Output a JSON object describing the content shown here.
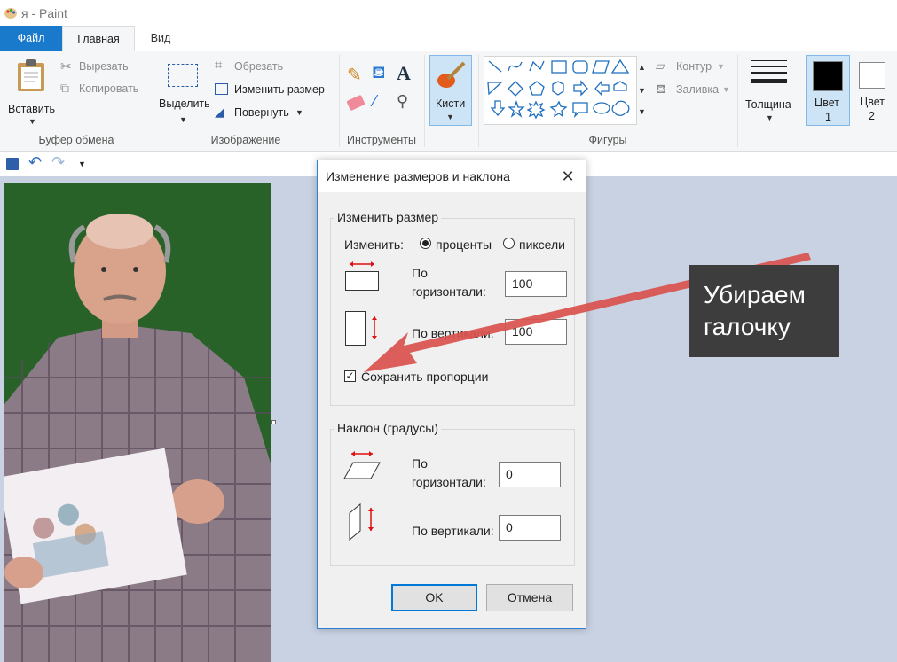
{
  "window": {
    "title": "я - Paint"
  },
  "tabs": {
    "file": "Файл",
    "home": "Главная",
    "view": "Вид"
  },
  "ribbon": {
    "clipboard": {
      "paste": "Вставить",
      "cut": "Вырезать",
      "copy": "Копировать",
      "group": "Буфер обмена"
    },
    "image": {
      "select": "Выделить",
      "crop": "Обрезать",
      "resize": "Изменить размер",
      "rotate": "Повернуть",
      "group": "Изображение"
    },
    "tools": {
      "group": "Инструменты"
    },
    "brushes": {
      "label": "Кисти"
    },
    "shapes": {
      "outline": "Контур",
      "fill": "Заливка",
      "group": "Фигуры"
    },
    "size": {
      "label": "Толщина"
    },
    "color1": {
      "line1": "Цвет",
      "line2": "1"
    },
    "color2": {
      "line1": "Цвет",
      "line2": "2"
    }
  },
  "dialog": {
    "title": "Изменение размеров и наклона",
    "resize_group": "Изменить размер",
    "by_label": "Изменить:",
    "percent": "проценты",
    "pixels": "пиксели",
    "horizontal_l1": "По",
    "horizontal_l2": "горизонтали:",
    "horizontal_value": "100",
    "vertical_label": "По вертикали:",
    "vertical_value": "100",
    "keep_ratio": "Сохранить пропорции",
    "keep_ratio_checked": true,
    "skew_group": "Наклон (градусы)",
    "skew_h_l1": "По",
    "skew_h_l2": "горизонтали:",
    "skew_h_value": "0",
    "skew_v_label": "По вертикали:",
    "skew_v_value": "0",
    "ok": "OK",
    "cancel": "Отмена"
  },
  "annotation": {
    "text": "Убираем галочку",
    "arrow_color": "#d9534f"
  },
  "colors": {
    "accent": "#1979ca",
    "color1": "#000000",
    "color2": "#ffffff"
  }
}
